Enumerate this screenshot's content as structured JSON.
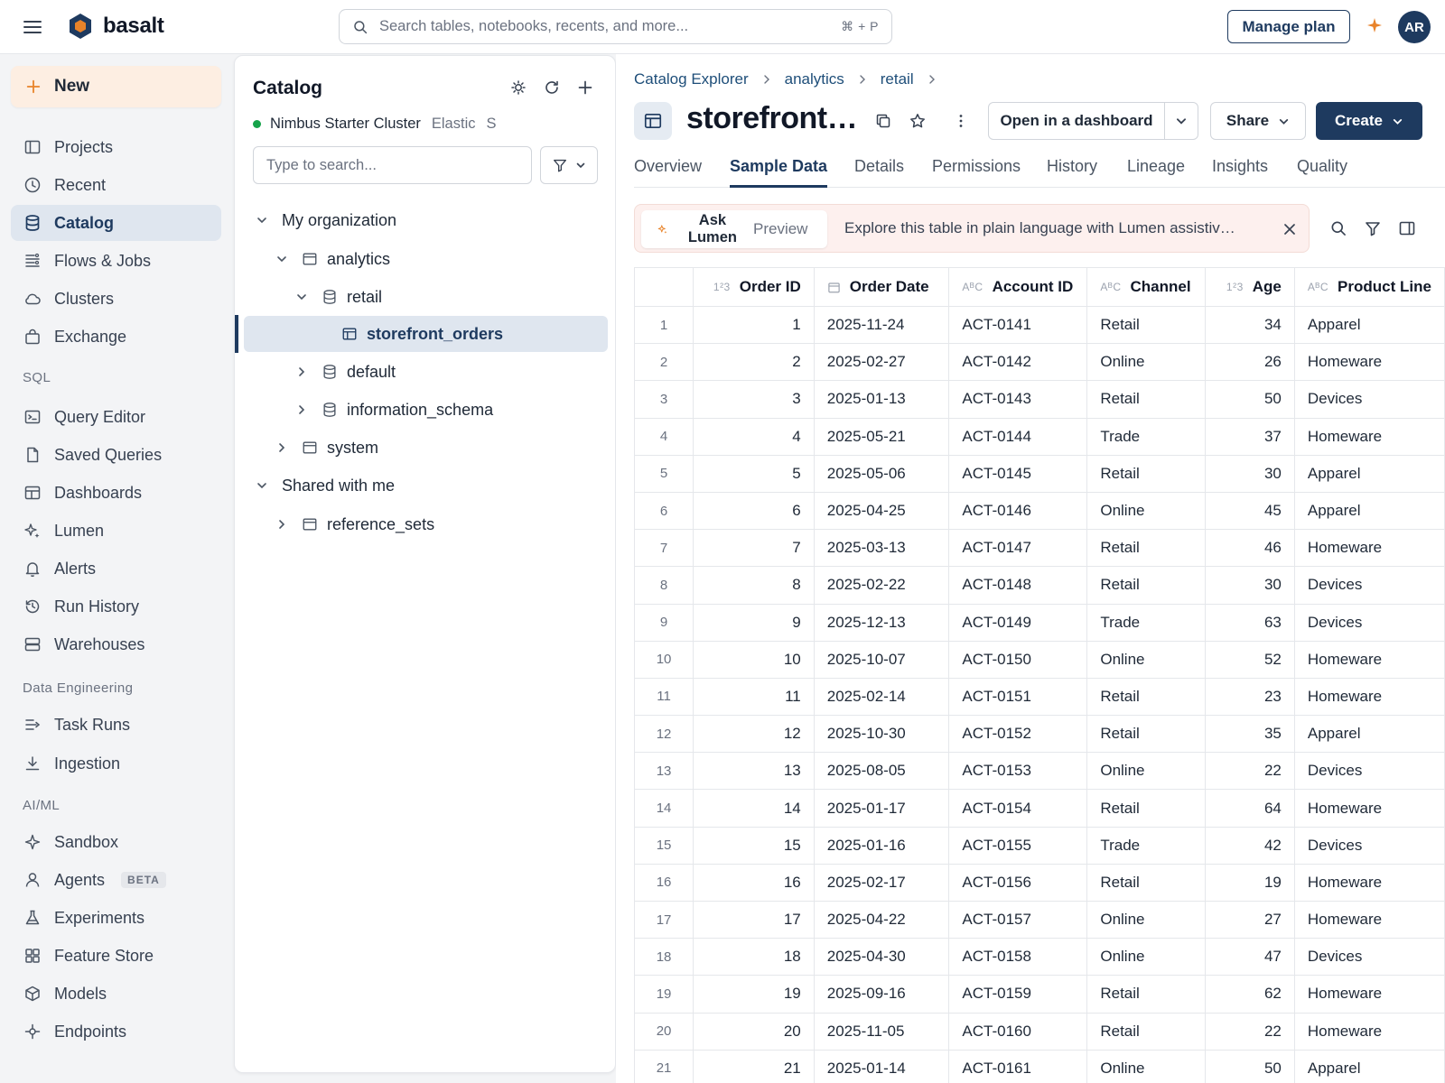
{
  "app": {
    "name": "basalt"
  },
  "topbar": {
    "search_placeholder": "Search tables, notebooks, recents, and more...",
    "search_shortcut": "⌘ + P",
    "manage_plan": "Manage plan",
    "avatar_initials": "AR"
  },
  "leftnav": {
    "new_label": "New",
    "items": [
      {
        "label": "Projects",
        "icon": "projects-icon"
      },
      {
        "label": "Recent",
        "icon": "clock-icon"
      },
      {
        "label": "Catalog",
        "icon": "database-icon",
        "active": true
      },
      {
        "label": "Flows & Jobs",
        "icon": "flows-icon"
      },
      {
        "label": "Clusters",
        "icon": "cloud-icon"
      },
      {
        "label": "Exchange",
        "icon": "bag-icon"
      }
    ],
    "sections": {
      "sql": {
        "title": "SQL",
        "items": [
          {
            "label": "Query Editor",
            "icon": "terminal-icon"
          },
          {
            "label": "Saved Queries",
            "icon": "file-icon"
          },
          {
            "label": "Dashboards",
            "icon": "dashboard-icon"
          },
          {
            "label": "Lumen",
            "icon": "sparkle-icon"
          },
          {
            "label": "Alerts",
            "icon": "bell-icon"
          },
          {
            "label": "Run History",
            "icon": "history-icon"
          },
          {
            "label": "Warehouses",
            "icon": "server-icon"
          }
        ]
      },
      "data_engineering": {
        "title": "Data Engineering",
        "items": [
          {
            "label": "Task Runs",
            "icon": "task-runs-icon"
          },
          {
            "label": "Ingestion",
            "icon": "download-icon"
          }
        ]
      },
      "aiml": {
        "title": "AI/ML",
        "items": [
          {
            "label": "Sandbox",
            "icon": "sandbox-icon"
          },
          {
            "label": "Agents",
            "icon": "agent-icon",
            "badge": "BETA"
          },
          {
            "label": "Experiments",
            "icon": "flask-icon"
          },
          {
            "label": "Feature Store",
            "icon": "grid-icon"
          },
          {
            "label": "Models",
            "icon": "cube-icon"
          },
          {
            "label": "Endpoints",
            "icon": "endpoint-icon"
          }
        ]
      }
    }
  },
  "catalog": {
    "title": "Catalog",
    "cluster_name": "Nimbus Starter Cluster",
    "cluster_type": "Elastic",
    "cluster_size": "S",
    "search_placeholder": "Type to search...",
    "tree": [
      {
        "label": "My organization"
      },
      {
        "label": "analytics"
      },
      {
        "label": "retail"
      },
      {
        "label": "storefront_orders"
      },
      {
        "label": "default"
      },
      {
        "label": "information_schema"
      },
      {
        "label": "system"
      },
      {
        "label": "Shared with me"
      },
      {
        "label": "reference_sets"
      }
    ]
  },
  "main": {
    "breadcrumbs": [
      "Catalog Explorer",
      "analytics",
      "retail"
    ],
    "table_name": "storefront_orders",
    "open_dashboard": "Open in a dashboard",
    "share": "Share",
    "create": "Create",
    "tabs": [
      "Overview",
      "Sample Data",
      "Details",
      "Permissions",
      "History",
      "Lineage",
      "Insights",
      "Quality"
    ],
    "active_tab": "Sample Data",
    "banner": {
      "ask_label": "Ask Lumen",
      "preview": "Preview",
      "text": "Explore this table in plain language with Lumen assistive …"
    }
  },
  "table": {
    "columns": [
      {
        "label": "Order ID",
        "type": "1²3"
      },
      {
        "label": "Order Date",
        "type": "date"
      },
      {
        "label": "Account ID",
        "type": "AᴮC"
      },
      {
        "label": "Channel",
        "type": "AᴮC"
      },
      {
        "label": "Age",
        "type": "1²3"
      },
      {
        "label": "Product Line",
        "type": "AᴮC"
      }
    ],
    "rows": [
      [
        "1",
        "1",
        "2025-11-24",
        "ACT-0141",
        "Retail",
        "34",
        "Apparel"
      ],
      [
        "2",
        "2",
        "2025-02-27",
        "ACT-0142",
        "Online",
        "26",
        "Homeware"
      ],
      [
        "3",
        "3",
        "2025-01-13",
        "ACT-0143",
        "Retail",
        "50",
        "Devices"
      ],
      [
        "4",
        "4",
        "2025-05-21",
        "ACT-0144",
        "Trade",
        "37",
        "Homeware"
      ],
      [
        "5",
        "5",
        "2025-05-06",
        "ACT-0145",
        "Retail",
        "30",
        "Apparel"
      ],
      [
        "6",
        "6",
        "2025-04-25",
        "ACT-0146",
        "Online",
        "45",
        "Apparel"
      ],
      [
        "7",
        "7",
        "2025-03-13",
        "ACT-0147",
        "Retail",
        "46",
        "Homeware"
      ],
      [
        "8",
        "8",
        "2025-02-22",
        "ACT-0148",
        "Retail",
        "30",
        "Devices"
      ],
      [
        "9",
        "9",
        "2025-12-13",
        "ACT-0149",
        "Trade",
        "63",
        "Devices"
      ],
      [
        "10",
        "10",
        "2025-10-07",
        "ACT-0150",
        "Online",
        "52",
        "Homeware"
      ],
      [
        "11",
        "11",
        "2025-02-14",
        "ACT-0151",
        "Retail",
        "23",
        "Homeware"
      ],
      [
        "12",
        "12",
        "2025-10-30",
        "ACT-0152",
        "Retail",
        "35",
        "Apparel"
      ],
      [
        "13",
        "13",
        "2025-08-05",
        "ACT-0153",
        "Online",
        "22",
        "Devices"
      ],
      [
        "14",
        "14",
        "2025-01-17",
        "ACT-0154",
        "Retail",
        "64",
        "Homeware"
      ],
      [
        "15",
        "15",
        "2025-01-16",
        "ACT-0155",
        "Trade",
        "42",
        "Devices"
      ],
      [
        "16",
        "16",
        "2025-02-17",
        "ACT-0156",
        "Retail",
        "19",
        "Homeware"
      ],
      [
        "17",
        "17",
        "2025-04-22",
        "ACT-0157",
        "Online",
        "27",
        "Homeware"
      ],
      [
        "18",
        "18",
        "2025-04-30",
        "ACT-0158",
        "Online",
        "47",
        "Devices"
      ],
      [
        "19",
        "19",
        "2025-09-16",
        "ACT-0159",
        "Retail",
        "62",
        "Homeware"
      ],
      [
        "20",
        "20",
        "2025-11-05",
        "ACT-0160",
        "Retail",
        "22",
        "Homeware"
      ],
      [
        "21",
        "21",
        "2025-01-14",
        "ACT-0161",
        "Online",
        "50",
        "Apparel"
      ]
    ]
  },
  "colors": {
    "brand": "#1e3a5f",
    "accent_orange": "#e8832a",
    "new_button_bg": "#fdeee2",
    "cluster_status": "#16a34a"
  }
}
